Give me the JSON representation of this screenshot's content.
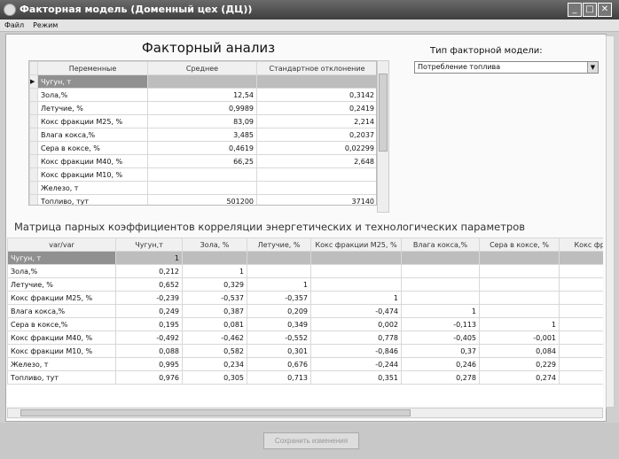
{
  "window": {
    "title": "Факторная модель (Доменный цех (ДЦ))",
    "controls": [
      "_",
      "□",
      "✕"
    ]
  },
  "menu": [
    "Файл",
    "Режим"
  ],
  "heading": "Факторный анализ",
  "model_type": {
    "label": "Тип факторной модели:",
    "selected": "Потребление топлива"
  },
  "stats_table": {
    "columns": [
      "Переменные",
      "Среднее",
      "Стандартное отклонение"
    ],
    "rows": [
      [
        "Чугун, т",
        "",
        ""
      ],
      [
        "Зола,%",
        "12,54",
        "0,3142"
      ],
      [
        "Летучие, %",
        "0,9989",
        "0,2419"
      ],
      [
        "Кокс фракции М25, %",
        "83,09",
        "2,214"
      ],
      [
        "Влага кокса,%",
        "3,485",
        "0,2037"
      ],
      [
        "Сера в коксе, %",
        "0,4619",
        "0,02299"
      ],
      [
        "Кокс фракции М40, %",
        "66,25",
        "2,648"
      ],
      [
        "Кокс фракции М10, %",
        "",
        ""
      ],
      [
        "Железо, т",
        "",
        ""
      ],
      [
        "Топливо, тут",
        "501200",
        "37140"
      ]
    ]
  },
  "matrix": {
    "title": "Матрица парных коэффициентов корреляции энергетических и технологических параметров",
    "columns": [
      "var/var",
      "Чугун,т",
      "Зола, %",
      "Летучие, %",
      "Кокс фракции М25, %",
      "Влага кокса,%",
      "Сера в коксе, %",
      "Кокс фрак"
    ],
    "rows": [
      [
        "Чугун, т",
        "1",
        "",
        "",
        "",
        "",
        "",
        ""
      ],
      [
        "Зола,%",
        "0,212",
        "1",
        "",
        "",
        "",
        "",
        ""
      ],
      [
        "Летучие, %",
        "0,652",
        "0,329",
        "1",
        "",
        "",
        "",
        ""
      ],
      [
        "Кокс фракции М25, %",
        "-0,239",
        "-0,537",
        "-0,357",
        "1",
        "",
        "",
        ""
      ],
      [
        "Влага кокса,%",
        "0,249",
        "0,387",
        "0,209",
        "-0,474",
        "1",
        "",
        ""
      ],
      [
        "Сера в коксе,%",
        "0,195",
        "0,081",
        "0,349",
        "0,002",
        "-0,113",
        "1",
        ""
      ],
      [
        "Кокс фракции М40, %",
        "-0,492",
        "-0,462",
        "-0,552",
        "0,778",
        "-0,405",
        "-0,001",
        ""
      ],
      [
        "Кокс фракции М10, %",
        "0,088",
        "0,582",
        "0,301",
        "-0,846",
        "0,37",
        "0,084",
        ""
      ],
      [
        "Железо, т",
        "0,995",
        "0,234",
        "0,676",
        "-0,244",
        "0,246",
        "0,229",
        ""
      ],
      [
        "Топливо, тут",
        "0,976",
        "0,305",
        "0,713",
        "0,351",
        "0,278",
        "0,274",
        ""
      ]
    ]
  },
  "save_button": "Сохранить изменения"
}
